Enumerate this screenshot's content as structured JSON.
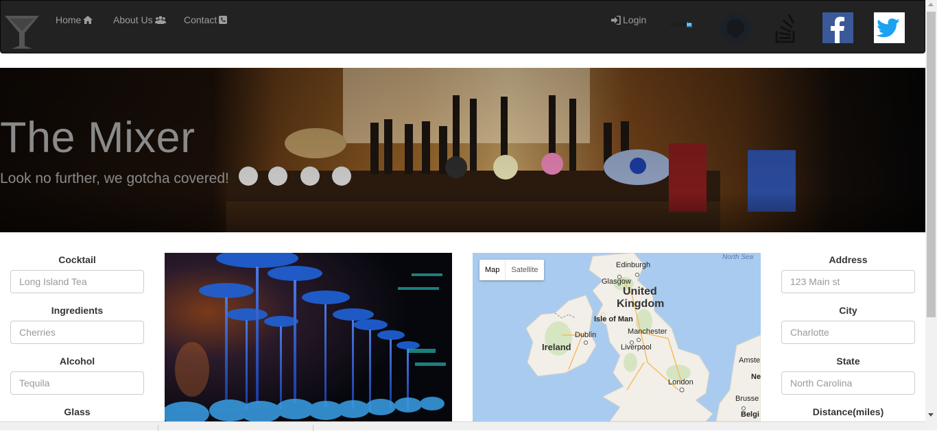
{
  "nav": {
    "links": [
      {
        "label": "Home",
        "icon": "home-icon"
      },
      {
        "label": "About Us",
        "icon": "users-icon"
      },
      {
        "label": "Contact",
        "icon": "phone-icon"
      }
    ],
    "login_label": "Login",
    "linkedin_text": "Linked",
    "linkedin_badge": "in"
  },
  "hero": {
    "title": "The Mixer",
    "subtitle": "Look no further, we gotcha covered!"
  },
  "left_form": {
    "fields": [
      {
        "label": "Cocktail",
        "placeholder": "Long Island Tea"
      },
      {
        "label": "Ingredients",
        "placeholder": "Cherries"
      },
      {
        "label": "Alcohol",
        "placeholder": "Tequila"
      },
      {
        "label": "Glass",
        "placeholder": ""
      }
    ]
  },
  "right_form": {
    "fields": [
      {
        "label": "Address",
        "placeholder": "123 Main st"
      },
      {
        "label": "City",
        "placeholder": "Charlotte"
      },
      {
        "label": "State",
        "placeholder": "North Carolina"
      },
      {
        "label": "Distance(miles)",
        "placeholder": ""
      }
    ]
  },
  "map": {
    "map_button": "Map",
    "satellite_button": "Satellite",
    "labels": {
      "north_sea": "North Sea",
      "edinburgh": "Edinburgh",
      "glasgow": "Glasgow",
      "united": "United",
      "kingdom": "Kingdom",
      "isle_of_man": "Isle of Man",
      "dublin": "Dublin",
      "ireland": "Ireland",
      "manchester": "Manchester",
      "liverpool": "Liverpool",
      "london": "London",
      "amsterdam": "Amste",
      "ne": "Ne",
      "brussels": "Brusse",
      "belgium": "Belgi"
    }
  },
  "colors": {
    "navbar_bg": "#222222",
    "nav_text": "#9d9d9d",
    "facebook": "#3b5998",
    "twitter": "#1da1f2",
    "map_water": "#a9cbef",
    "map_land": "#f2efe9"
  }
}
